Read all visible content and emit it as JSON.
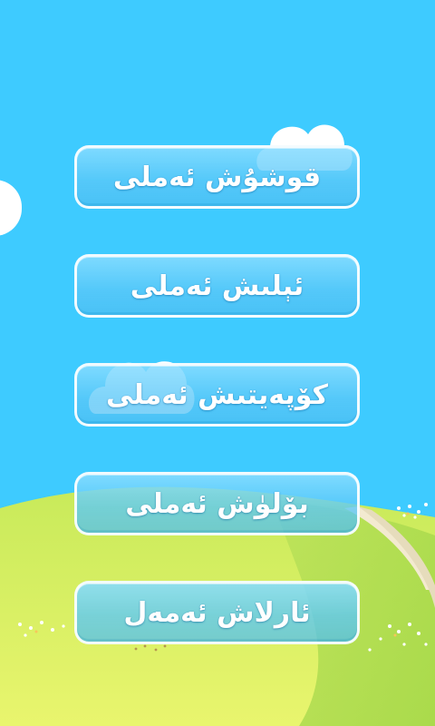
{
  "menu": {
    "items": [
      {
        "label": "قوشۇش ئەملى"
      },
      {
        "label": "ئېلىش ئەملى"
      },
      {
        "label": "كۆپەيتىش ئەملى"
      },
      {
        "label": "بۆلۈش ئەملى"
      },
      {
        "label": "ئارلاش ئەمەل"
      }
    ]
  },
  "colors": {
    "sky": "#3ecbff",
    "grass_light": "#e8f26a",
    "grass_dark": "#a6d94a",
    "path": "#f0e6c8",
    "button_border": "#ffffff",
    "button_fill": "#7fd8ff",
    "label_text": "#ffffff"
  },
  "icons": [
    "cloud-shape",
    "grass-hill",
    "dirt-path",
    "flower-dots"
  ]
}
